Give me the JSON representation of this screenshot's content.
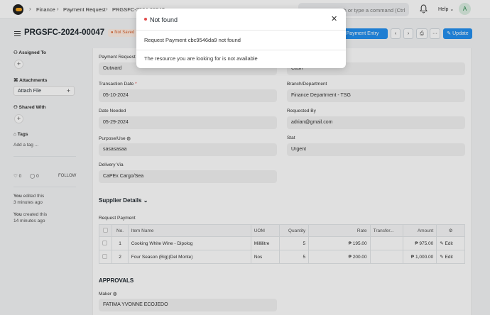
{
  "navbar": {
    "breadcrumbs": [
      "Finance",
      "Payment Request",
      "PRGSFC-2024-00047"
    ],
    "search_hint": "Search or type a command (Ctrl + G)",
    "help_label": "Help",
    "avatar_initial": "A"
  },
  "page": {
    "title": "PRGSFC-2024-00047",
    "status_badge": "Not Saved",
    "create_payment_entry": "Create Payment Entry",
    "update_label": "Update",
    "more_label": "···"
  },
  "sidebar": {
    "assigned_to": "Assigned To",
    "attachments": "Attachments",
    "attach_file": "Attach File",
    "shared_with": "Shared With",
    "tags": "Tags",
    "add_tag": "Add a tag ...",
    "likes": "0",
    "comments": "0",
    "follow": "FOLLOW",
    "activity": [
      {
        "who": "You",
        "what": "edited this",
        "when": "3 minutes ago"
      },
      {
        "who": "You",
        "what": "created this",
        "when": "14 minutes ago"
      }
    ]
  },
  "form": {
    "payment_request_label": "Payment Request",
    "payment_request_value": "Outward",
    "mode_value": "Cash",
    "transaction_date_label": "Transaction Date",
    "transaction_date_value": "05-10-2024",
    "branch_label": "Branch/Department",
    "branch_value": "Finance Department - TSG",
    "date_needed_label": "Date Needed",
    "date_needed_value": "05-29-2024",
    "requested_by_label": "Requested By",
    "requested_by_value": "adrian@gmail.com",
    "purpose_label": "Purpose/Use",
    "purpose_value": "sasasasaa",
    "stat_label": "Stat",
    "stat_value": "Urgent",
    "delivery_label": "Delivery Via",
    "delivery_value": "CaPEx Cargo/Sea"
  },
  "supplier": {
    "section_title": "Supplier Details",
    "table_label": "Request Payment",
    "columns": [
      "No.",
      "Item Name",
      "UOM",
      "Quantity",
      "Rate",
      "Transfer...",
      "Amount"
    ],
    "rows": [
      {
        "no": "1",
        "item": "Cooking White Wine - Dipolog",
        "uom": "Millilitre",
        "qty": "5",
        "rate": "₱ 195.00",
        "transfer": "",
        "amount": "₱ 975.00",
        "edit": "Edit"
      },
      {
        "no": "2",
        "item": "Four Season (Big)(Del Monte)",
        "uom": "Nos",
        "qty": "5",
        "rate": "₱ 200.00",
        "transfer": "",
        "amount": "₱ 1,000.00",
        "edit": "Edit"
      }
    ]
  },
  "approvals": {
    "section_title": "APPROVALS",
    "maker_label": "Maker",
    "maker_value": "FATIMA YVONNE ECOJEDO"
  },
  "modal": {
    "title": "Not found",
    "message": "Request Payment cbc9546da9 not found",
    "detail": "The resource you are looking for is not available"
  }
}
